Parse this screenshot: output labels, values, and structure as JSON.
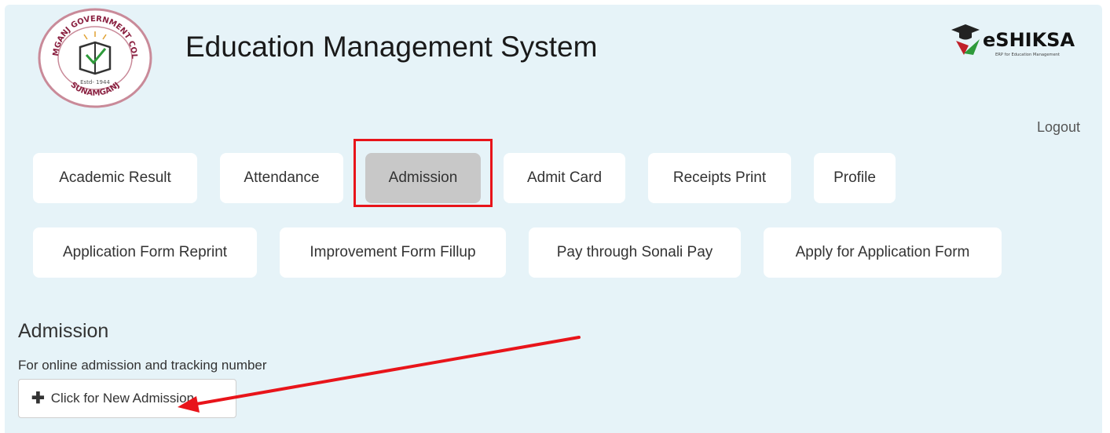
{
  "header": {
    "title": "Education Management System",
    "college_logo": {
      "top_text": "SUNAMGANJ GOVERNMENT COLLEGE",
      "bottom_text": "SUNAMGANJ",
      "estd": "Estd- 1944"
    },
    "brand_logo": {
      "name": "eSHIKSA",
      "tagline": "ERP for Education Management"
    }
  },
  "logout": {
    "label": "Logout"
  },
  "nav": {
    "row1": [
      "Academic Result",
      "Attendance",
      "Admission",
      "Admit Card",
      "Receipts Print",
      "Profile"
    ],
    "row2": [
      "Application Form Reprint",
      "Improvement Form Fillup",
      "Pay through Sonali Pay",
      "Apply for Application Form"
    ],
    "active": "Admission"
  },
  "section": {
    "title": "Admission",
    "description": "For online admission and tracking number",
    "button_label": "Click for New Admission",
    "button_icon": "plus-icon"
  },
  "annotations": {
    "highlight_color": "#e8141a",
    "arrow_color": "#e8141a"
  },
  "colors": {
    "panel_background": "#e6f3f8",
    "active_button": "#c8c8c8"
  }
}
